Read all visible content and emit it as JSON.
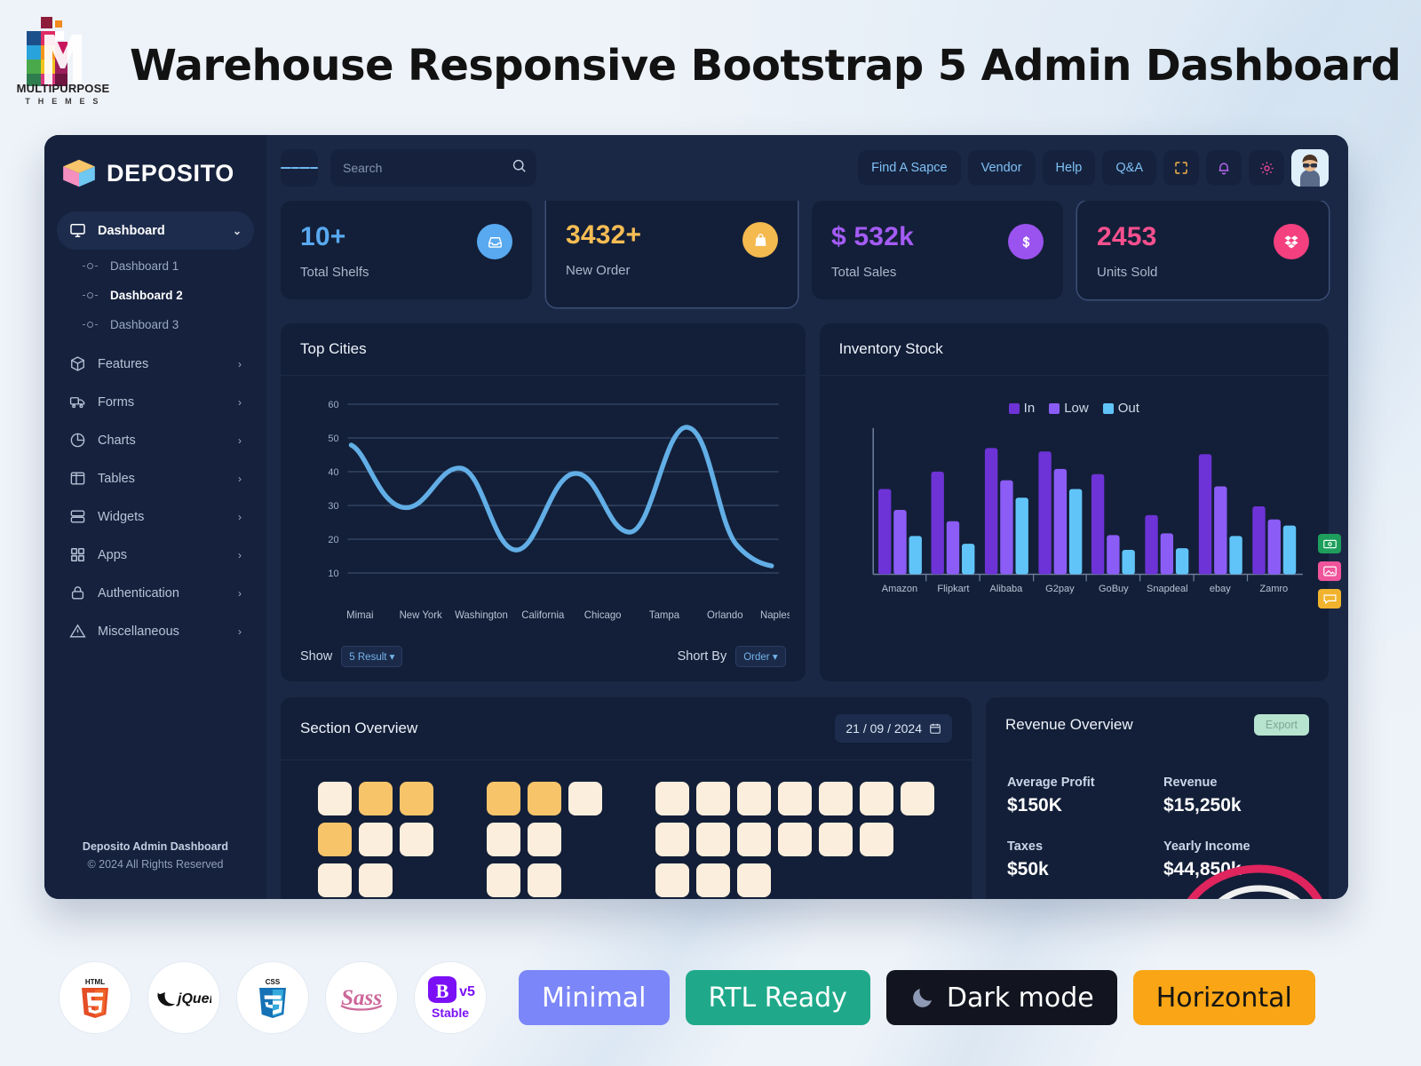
{
  "banner": {
    "title": "Warehouse Responsive Bootstrap 5 Admin Dashboard",
    "logo_caption": "MULTIPURPOSE",
    "logo_subcaption": "T H E M E S"
  },
  "sidebar": {
    "brand": "DEPOSITO",
    "items": [
      {
        "label": "Dashboard",
        "icon": "monitor-icon",
        "active": true,
        "caret": "chevron-down-icon"
      },
      {
        "label": "Features",
        "icon": "box-icon",
        "caret": "chevron-right-icon"
      },
      {
        "label": "Forms",
        "icon": "truck-icon",
        "caret": "chevron-right-icon"
      },
      {
        "label": "Charts",
        "icon": "pie-chart-icon",
        "caret": "chevron-right-icon"
      },
      {
        "label": "Tables",
        "icon": "table-icon",
        "caret": "chevron-right-icon"
      },
      {
        "label": "Widgets",
        "icon": "widgets-icon",
        "caret": "chevron-right-icon"
      },
      {
        "label": "Apps",
        "icon": "grid-icon",
        "caret": "chevron-right-icon"
      },
      {
        "label": "Authentication",
        "icon": "lock-icon",
        "caret": "chevron-right-icon"
      },
      {
        "label": "Miscellaneous",
        "icon": "alert-triangle-icon",
        "caret": "chevron-right-icon"
      }
    ],
    "sub_items": [
      {
        "label": "Dashboard 1",
        "current": false
      },
      {
        "label": "Dashboard 2",
        "current": true
      },
      {
        "label": "Dashboard 3",
        "current": false
      }
    ],
    "footer_line1": "Deposito Admin Dashboard",
    "footer_line2": "© 2024 All Rights Reserved"
  },
  "topbar": {
    "search_placeholder": "Search",
    "search_value": "",
    "links": [
      "Find A Sapce",
      "Vendor",
      "Help",
      "Q&A"
    ],
    "icons": [
      "fullscreen-icon",
      "bell-icon",
      "gear-icon",
      "avatar"
    ]
  },
  "stats": [
    {
      "value": "10+",
      "label": "Total Shelfs",
      "color": "#58a9f0",
      "badge_bg": "#58a9f0",
      "icon": "inbox-icon"
    },
    {
      "value": "3432+",
      "label": "New Order",
      "color": "#f7bd54",
      "badge_bg": "#f4b94f",
      "icon": "bag-icon"
    },
    {
      "value": "$ 532k",
      "label": "Total Sales",
      "color": "#a45cf5",
      "badge_bg": "#9a53ef",
      "icon": "dollar-icon"
    },
    {
      "value": "2453",
      "label": "Units Sold",
      "color": "#f9508f",
      "badge_bg": "#f4407f",
      "icon": "dropbox-icon"
    }
  ],
  "top_cities": {
    "title": "Top Cities",
    "show_label": "Show",
    "show_value": "5 Result",
    "sort_label": "Short By",
    "sort_value": "Order"
  },
  "inventory": {
    "title": "Inventory Stock"
  },
  "section_overview": {
    "title": "Section Overview",
    "date": "21 / 09 / 2024",
    "groups": [
      {
        "rows": [
          [
            "n",
            "h",
            "h"
          ],
          [
            "h",
            "n",
            "n"
          ],
          [
            "n",
            "n"
          ],
          [
            "n",
            "n",
            "n"
          ]
        ]
      },
      {
        "rows": [
          [
            "h",
            "h",
            "n"
          ],
          [
            "n",
            "n"
          ],
          [
            "n",
            "n"
          ],
          [
            "n",
            "n",
            "n"
          ]
        ]
      },
      {
        "rows": [
          [
            "n",
            "n",
            "n",
            "n",
            "n",
            "n",
            "n"
          ],
          [
            "n",
            "n",
            "n",
            "n",
            "n",
            "n"
          ],
          [
            "n",
            "n",
            "n"
          ],
          [
            "n",
            "n",
            "n"
          ]
        ]
      }
    ]
  },
  "revenue": {
    "title": "Revenue Overview",
    "export_label": "Export",
    "metrics": [
      {
        "key": "Average Profit",
        "value": "$150K"
      },
      {
        "key": "Revenue",
        "value": "$15,250k"
      },
      {
        "key": "Taxes",
        "value": "$50k"
      },
      {
        "key": "Yearly Income",
        "value": "$44,850k"
      }
    ]
  },
  "footer_badges": {
    "circles": [
      "HTML5",
      "jQuery",
      "CSS3",
      "Sass",
      "Bootstrap v5 Stable"
    ],
    "tags": [
      "Minimal",
      "RTL Ready",
      "Dark mode",
      "Horizontal"
    ]
  },
  "chart_data": [
    {
      "type": "line",
      "title": "Top Cities",
      "xlabel": "",
      "ylabel": "",
      "categories": [
        "Mimai",
        "New York",
        "Washington",
        "California",
        "Chicago",
        "Tampa",
        "Orlando",
        "Naples"
      ],
      "values": [
        48,
        31,
        42,
        17,
        41,
        24,
        54,
        19
      ],
      "yticks": [
        10,
        20,
        30,
        40,
        50,
        60
      ],
      "ylim": [
        10,
        60
      ],
      "grid": true,
      "legend": "none",
      "line_color": "#62aee6"
    },
    {
      "type": "bar",
      "title": "Inventory Stock",
      "xlabel": "",
      "ylabel": "",
      "categories": [
        "Amazon",
        "Flipkart",
        "Alibaba",
        "G2pay",
        "GoBuy",
        "Snapdeal",
        "ebay",
        "Zamro"
      ],
      "series": [
        {
          "name": "In",
          "color": "#6d33d6",
          "values": [
            58,
            70,
            86,
            84,
            68,
            40,
            82,
            46
          ]
        },
        {
          "name": "Low",
          "color": "#8b5cf6",
          "values": [
            44,
            36,
            64,
            72,
            27,
            28,
            60,
            40
          ]
        },
        {
          "name": "Out",
          "color": "#61c4f8",
          "values": [
            26,
            21,
            52,
            58,
            17,
            18,
            26,
            36
          ]
        }
      ],
      "ylim": [
        0,
        100
      ],
      "grid": false,
      "legend": "top-center"
    }
  ]
}
